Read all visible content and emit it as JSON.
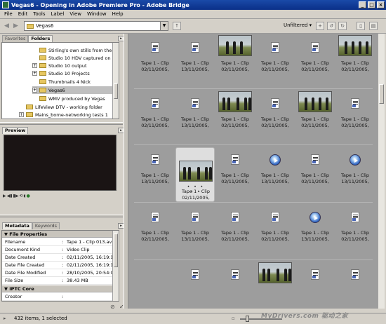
{
  "window": {
    "title": "Vegas6 - Opening in Adobe Premiere Pro - Adobe Bridge",
    "buttons": [
      "_",
      "□",
      "×"
    ]
  },
  "menu": [
    "File",
    "Edit",
    "Tools",
    "Label",
    "View",
    "Window",
    "Help"
  ],
  "toolbar": {
    "path": "Vegas6",
    "filter": "Unfiltered ▾"
  },
  "left_tabs": [
    "Favorites",
    "Folders"
  ],
  "folders": [
    {
      "label": "Stirling's own stills from the even",
      "expander": ""
    },
    {
      "label": "Studio 10 HDV captured on Mesh",
      "expander": ""
    },
    {
      "label": "Studio 10 output",
      "expander": "+"
    },
    {
      "label": "Studio 10 Projects",
      "expander": "+"
    },
    {
      "label": "Thumbnails 4 Nick",
      "expander": ""
    },
    {
      "label": "Vegas6",
      "expander": "+",
      "selected": true
    },
    {
      "label": "WMV produced by Vegas",
      "expander": ""
    },
    {
      "label": "LifeView DTV - working folder",
      "expander": ""
    },
    {
      "label": "Mains_borne-networking tests 1",
      "expander": "+"
    }
  ],
  "preview": {
    "tab": "Preview"
  },
  "meta_tabs": [
    "Metadata",
    "Keywords"
  ],
  "metadata": {
    "section1": "File Properties",
    "rows": [
      {
        "key": "Filename",
        "value": "Tape 1 - Clip 013.avi"
      },
      {
        "key": "Document Kind",
        "value": "Video Clip"
      },
      {
        "key": "Date Created",
        "value": "02/11/2005, 16:19:16"
      },
      {
        "key": "Date File Created",
        "value": "02/11/2005, 16:19:16"
      },
      {
        "key": "Date File Modified",
        "value": "28/10/2005, 20:54:09"
      },
      {
        "key": "File Size",
        "value": "38.43 MB"
      }
    ],
    "section2": "IPTC Core",
    "creator_key": "Creator",
    "creator_value": ""
  },
  "clip_label": "Tape 1 - Clip",
  "thumb_rows": [
    [
      {
        "kind": "doc",
        "date": "02/11/2005,"
      },
      {
        "kind": "doc",
        "date": "13/11/2005,"
      },
      {
        "kind": "photo",
        "date": "02/11/2005,"
      },
      {
        "kind": "doc",
        "date": "02/11/2005,"
      },
      {
        "kind": "doc",
        "date": "02/11/2005,"
      },
      {
        "kind": "photo",
        "date": "02/11/2005,"
      }
    ],
    [
      {
        "kind": "doc",
        "date": "02/11/2005,"
      },
      {
        "kind": "doc",
        "date": "13/11/2005,"
      },
      {
        "kind": "photo",
        "date": "02/11/2005,"
      },
      {
        "kind": "doc",
        "date": "02/11/2005,"
      },
      {
        "kind": "photo",
        "date": "02/11/2005,"
      },
      {
        "kind": "doc",
        "date": "02/11/2005,"
      }
    ],
    [
      {
        "kind": "doc",
        "date": "13/11/2005,"
      },
      {
        "kind": "photo",
        "date": "02/11/2005,",
        "selected": true
      },
      {
        "kind": "doc",
        "date": "02/11/2005,"
      },
      {
        "kind": "media",
        "date": "13/11/2005,"
      },
      {
        "kind": "doc",
        "date": "02/11/2005,"
      },
      {
        "kind": "media",
        "date": "13/11/2005,"
      }
    ],
    [
      {
        "kind": "doc",
        "date": "02/11/2005,"
      },
      {
        "kind": "doc",
        "date": "13/11/2005,"
      },
      {
        "kind": "doc",
        "date": "02/11/2005,"
      },
      {
        "kind": "doc",
        "date": "02/11/2005,"
      },
      {
        "kind": "media",
        "date": "13/11/2005,"
      },
      {
        "kind": "doc",
        "date": "02/11/2005,"
      }
    ],
    [
      {
        "kind": "none",
        "date": ""
      },
      {
        "kind": "doc",
        "date": ""
      },
      {
        "kind": "doc",
        "date": ""
      },
      {
        "kind": "photo",
        "date": ""
      },
      {
        "kind": "doc",
        "date": ""
      },
      {
        "kind": "doc",
        "date": ""
      }
    ]
  ],
  "status": {
    "text": "432 items, 1 selected"
  },
  "watermark": "MyDrivers.com 驱动之家"
}
